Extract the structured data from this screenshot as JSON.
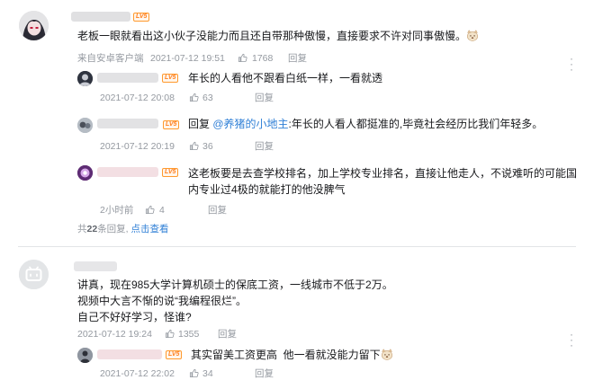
{
  "comments": [
    {
      "level_badge": "LV5",
      "text": "老板一眼就看出这小伙子没能力而且还自带那种傲慢，直接要求不许对同事傲慢。",
      "emoji_name": "dog-emoji",
      "device": "来自安卓客户端",
      "time": "2021-07-12 19:51",
      "likes": "1768",
      "reply_label": "回复",
      "replies": [
        {
          "level_badge": "LV5",
          "text": "年长的人看他不跟看白纸一样，一看就透",
          "time": "2021-07-12 20:08",
          "likes": "63",
          "reply_label": "回复"
        },
        {
          "level_badge": "LV5",
          "reply_prefix": "回复",
          "mention": "@养猪的小地主",
          "text": ":年长的人看人都挺准的,毕竟社会经历比我们年轻多。",
          "time": "2021-07-12 20:19",
          "likes": "36",
          "reply_label": "回复"
        },
        {
          "level_badge": "LV5",
          "text": "这老板要是去查学校排名，加上学校专业排名，直接让他走人，不说难听的可能国内专业过4极的就能打的他没脾气",
          "time": "2小时前",
          "likes": "4",
          "reply_label": "回复"
        }
      ],
      "footer_count_prefix": "共",
      "footer_count": "22",
      "footer_count_suffix": "条回复,",
      "footer_link": "点击查看"
    },
    {
      "text_lines": [
        "讲真，现在985大学计算机硕士的保底工资，一线城市不低于2万。",
        "视频中大言不惭的说“我编程很烂”。",
        "自己不好好学习，怪谁?"
      ],
      "time": "2021-07-12 19:24",
      "likes": "1355",
      "reply_label": "回复",
      "replies": [
        {
          "level_badge": "LV5",
          "text": "其实留美工资更高  他一看就没能力留下",
          "emoji_name": "dog-emoji",
          "time": "2021-07-12 22:02",
          "likes": "34",
          "reply_label": "回复"
        }
      ]
    }
  ],
  "colors": {
    "meta": "#9499a0",
    "link": "#2f7fd6",
    "badge": "#ff7f1e",
    "divider": "#e3e5e7"
  }
}
